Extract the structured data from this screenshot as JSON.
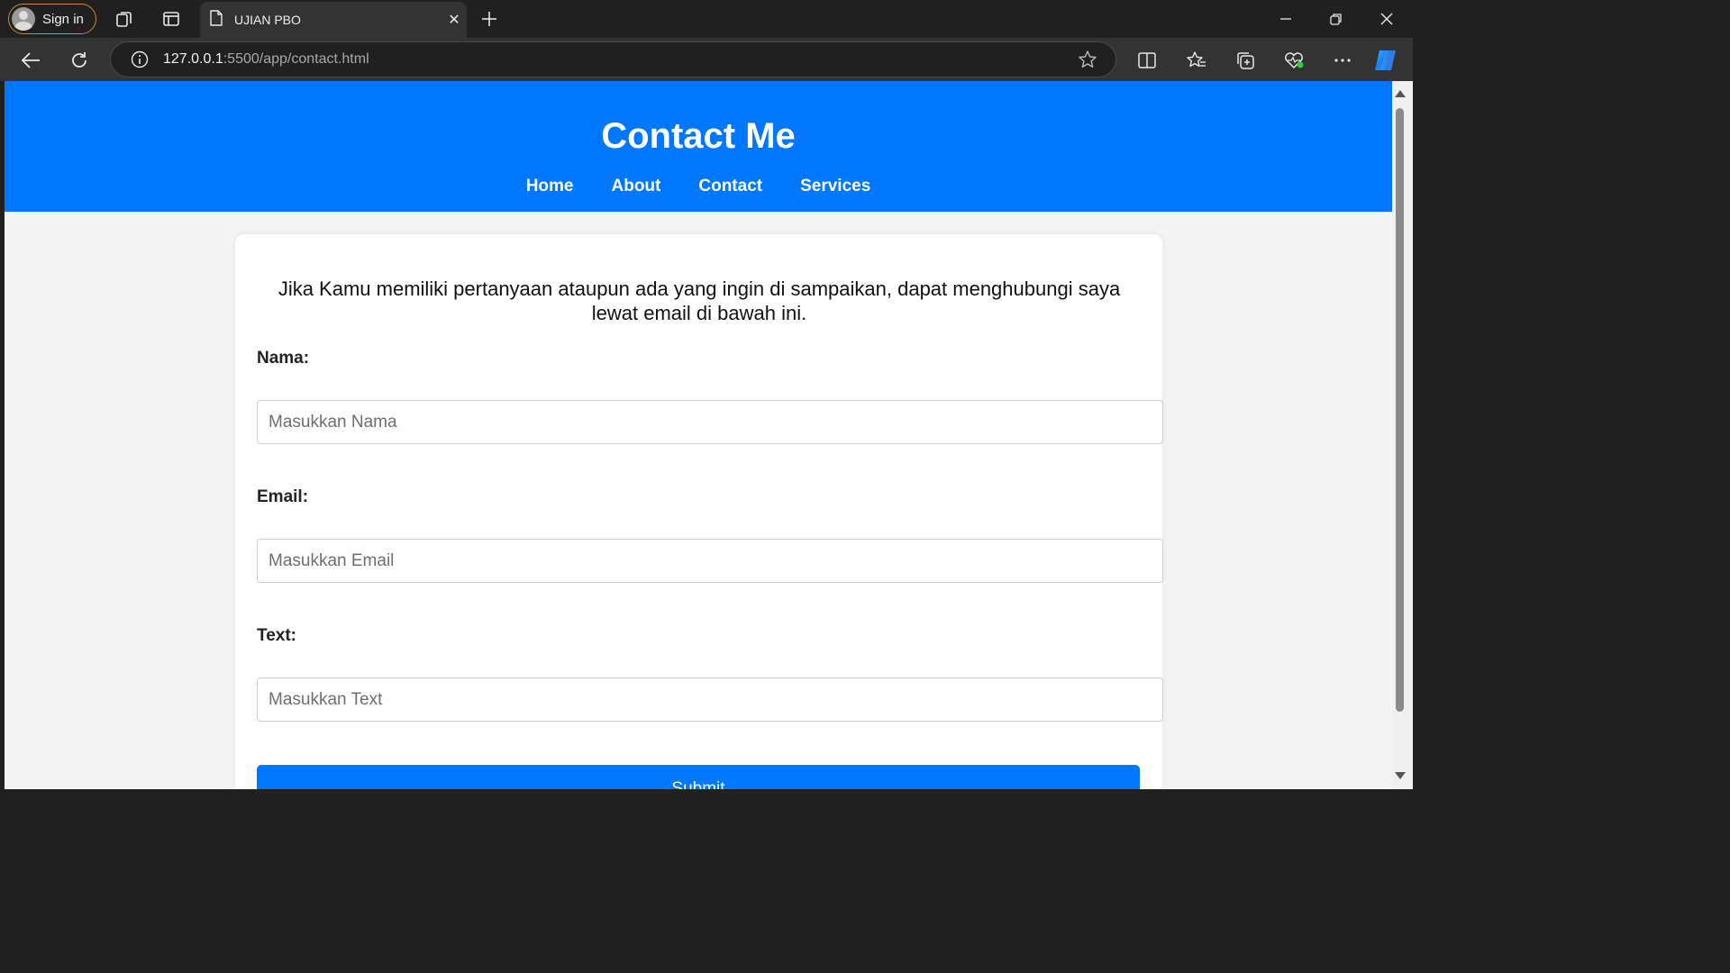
{
  "browser": {
    "signin_label": "Sign in",
    "tab_title": "UJIAN PBO",
    "url_host": "127.0.0.1",
    "url_path": ":5500/app/contact.html"
  },
  "page": {
    "title": "Contact Me",
    "nav": [
      "Home",
      "About",
      "Contact",
      "Services"
    ],
    "intro": "Jika Kamu memiliki pertanyaan ataupun ada yang ingin di sampaikan, dapat menghubungi saya lewat email di bawah ini.",
    "form": {
      "name_label": "Nama:",
      "name_placeholder": "Masukkan Nama",
      "email_label": "Email:",
      "email_placeholder": "Masukkan Email",
      "text_label": "Text:",
      "text_placeholder": "Masukkan Text",
      "submit_label": "Submit"
    }
  },
  "colors": {
    "accent": "#0077ff",
    "chrome_dark": "#202020",
    "chrome_toolbar": "#333333",
    "page_background": "#f4f4f4"
  }
}
